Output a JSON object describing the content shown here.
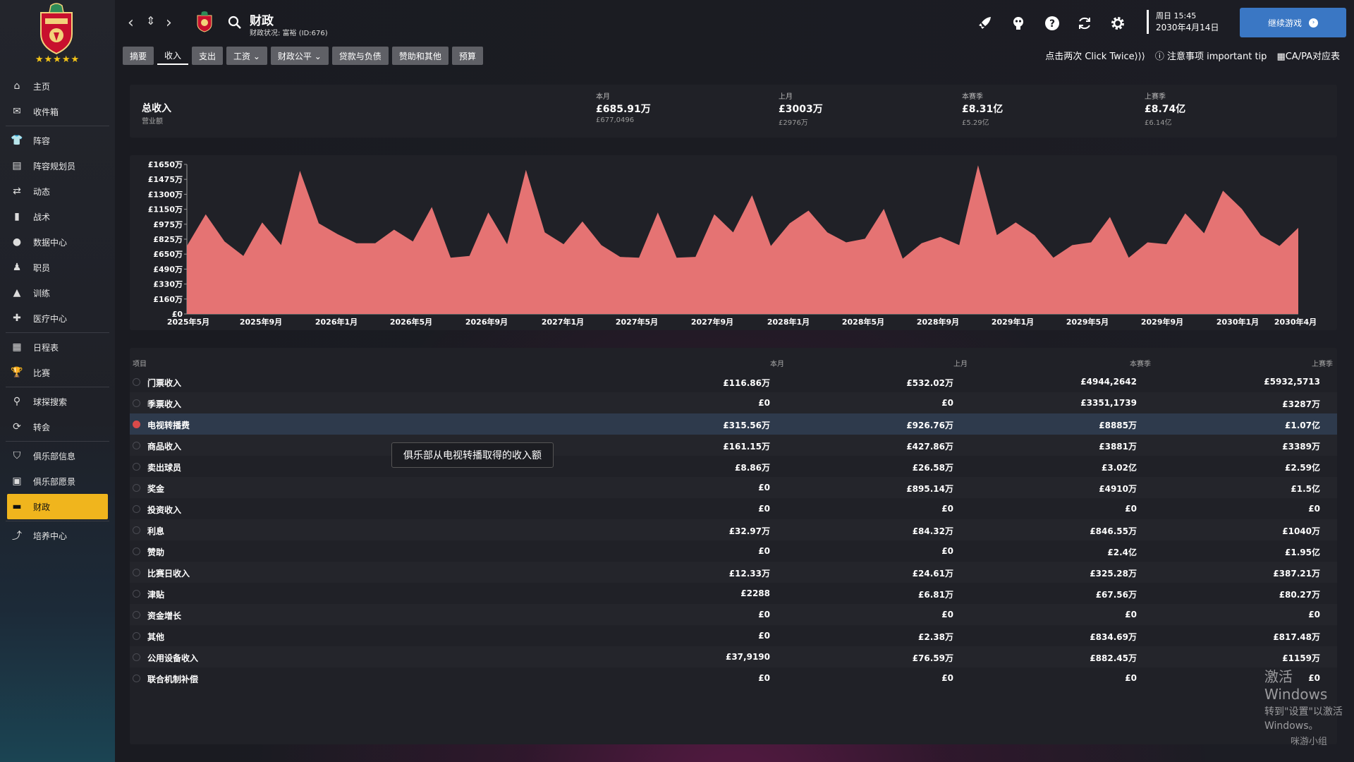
{
  "sidebar": {
    "stars": "★★★★★",
    "items": [
      {
        "label": "主页",
        "icon": "home-icon"
      },
      {
        "label": "收件箱",
        "icon": "inbox-icon"
      },
      {
        "label": "阵容",
        "icon": "squad-icon"
      },
      {
        "label": "阵容规划员",
        "icon": "planner-icon"
      },
      {
        "label": "动态",
        "icon": "dynamics-icon"
      },
      {
        "label": "战术",
        "icon": "tactics-icon"
      },
      {
        "label": "数据中心",
        "icon": "data-hub-icon"
      },
      {
        "label": "职员",
        "icon": "staff-icon"
      },
      {
        "label": "训练",
        "icon": "training-icon"
      },
      {
        "label": "医疗中心",
        "icon": "medical-icon"
      },
      {
        "label": "日程表",
        "icon": "calendar-icon"
      },
      {
        "label": "比赛",
        "icon": "trophy-icon"
      },
      {
        "label": "球探搜索",
        "icon": "search-icon"
      },
      {
        "label": "转会",
        "icon": "transfer-icon"
      },
      {
        "label": "俱乐部信息",
        "icon": "shield-icon"
      },
      {
        "label": "俱乐部愿景",
        "icon": "vision-icon"
      },
      {
        "label": "财政",
        "icon": "finance-icon"
      },
      {
        "label": "培养中心",
        "icon": "development-icon"
      }
    ]
  },
  "header": {
    "title": "财政",
    "subtitle": "财政状况: 富裕 (ID:676)",
    "date_line1": "周日 15:45",
    "date_line2": "2030年4月14日",
    "continue_label": "继续游戏"
  },
  "tabs": [
    {
      "label": "摘要"
    },
    {
      "label": "收入",
      "active": true
    },
    {
      "label": "支出"
    },
    {
      "label": "工资 ⌄"
    },
    {
      "label": "财政公平 ⌄"
    },
    {
      "label": "贷款与负债"
    },
    {
      "label": "赞助和其他"
    },
    {
      "label": "预算"
    }
  ],
  "tips": {
    "click_twice": "点击两次 Click Twice⟩⟩⟩",
    "important": "注意事项 important tip",
    "capa": "CA/PA对应表"
  },
  "summary": {
    "title": "总收入",
    "subtitle": "营业额",
    "stats": [
      {
        "label": "本月",
        "value": "£685.91万",
        "sub": "£677,0496"
      },
      {
        "label": "上月",
        "value": "£3003万",
        "sub": "£2976万"
      },
      {
        "label": "本赛季",
        "value": "£8.31亿",
        "sub": "£5.29亿"
      },
      {
        "label": "上赛季",
        "value": "£8.74亿",
        "sub": "£6.14亿"
      }
    ]
  },
  "chart_data": {
    "type": "area",
    "color": "#e57373",
    "y_ticks": [
      "£1650万",
      "£1475万",
      "£1300万",
      "£1150万",
      "£975万",
      "£825万",
      "£650万",
      "£490万",
      "£330万",
      "£160万",
      "£0"
    ],
    "x_ticks": [
      "2025年5月",
      "2025年9月",
      "2026年1月",
      "2026年5月",
      "2026年9月",
      "2027年1月",
      "2027年5月",
      "2027年9月",
      "2028年1月",
      "2028年5月",
      "2028年9月",
      "2029年1月",
      "2029年5月",
      "2029年9月",
      "2030年1月",
      "2030年4月"
    ],
    "ylim": [
      0,
      1650
    ],
    "values": [
      750,
      1100,
      800,
      640,
      1010,
      760,
      1580,
      1000,
      880,
      780,
      780,
      930,
      800,
      1180,
      620,
      640,
      1120,
      770,
      1590,
      900,
      770,
      1020,
      760,
      630,
      620,
      1120,
      620,
      630,
      1100,
      900,
      1310,
      750,
      1000,
      1140,
      900,
      790,
      830,
      1160,
      610,
      780,
      850,
      760,
      1640,
      870,
      1010,
      870,
      620,
      760,
      790,
      1070,
      620,
      790,
      770,
      1110,
      890,
      1360,
      1160,
      870,
      750,
      950
    ],
    "unit": "万"
  },
  "table": {
    "headers": {
      "item": "项目",
      "this_month": "本月",
      "last_month": "上月",
      "this_season": "本赛季",
      "last_season": "上赛季"
    },
    "rows": [
      [
        "门票收入",
        "£116.86万",
        "£532.02万",
        "£4944,2642",
        "£5932,5713"
      ],
      [
        "季票收入",
        "£0",
        "£0",
        "£3351,1739",
        "£3287万"
      ],
      [
        "电视转播费",
        "£315.56万",
        "£926.76万",
        "£8885万",
        "£1.07亿"
      ],
      [
        "商品收入",
        "£161.15万",
        "£427.86万",
        "£3881万",
        "£3389万"
      ],
      [
        "卖出球员",
        "£8.86万",
        "£26.58万",
        "£3.02亿",
        "£2.59亿"
      ],
      [
        "奖金",
        "£0",
        "£895.14万",
        "£4910万",
        "£1.5亿"
      ],
      [
        "投资收入",
        "£0",
        "£0",
        "£0",
        "£0"
      ],
      [
        "利息",
        "£32.97万",
        "£84.32万",
        "£846.55万",
        "£1040万"
      ],
      [
        "赞助",
        "£0",
        "£0",
        "£2.4亿",
        "£1.95亿"
      ],
      [
        "比赛日收入",
        "£12.33万",
        "£24.61万",
        "£325.28万",
        "£387.21万"
      ],
      [
        "津贴",
        "£2288",
        "£6.81万",
        "£67.56万",
        "£80.27万"
      ],
      [
        "资金增长",
        "£0",
        "£0",
        "£0",
        "£0"
      ],
      [
        "其他",
        "£0",
        "£2.38万",
        "£834.69万",
        "£817.48万"
      ],
      [
        "公用设备收入",
        "£37,9190",
        "£76.59万",
        "£882.45万",
        "£1159万"
      ],
      [
        "联合机制补偿",
        "£0",
        "£0",
        "£0",
        "£0"
      ]
    ],
    "highlight_index": 2
  },
  "tooltip": "俱乐部从电视转播取得的收入额",
  "watermark": {
    "line1": "激活 Windows",
    "line2": "转到\"设置\"以激活 Windows。",
    "logo": "咪游小组"
  }
}
